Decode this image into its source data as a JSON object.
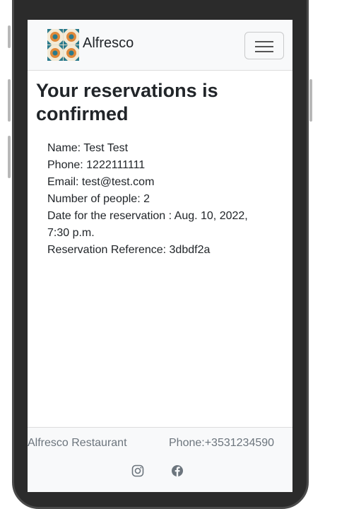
{
  "header": {
    "brand": "Alfresco",
    "menu_icon": "hamburger-menu-icon"
  },
  "main": {
    "title": "Your reservations is confirmed",
    "details": [
      "Name: Test Test",
      "Phone: 1222111111",
      "Email: test@test.com",
      "Number of people: 2",
      "Date for the reservation : Aug. 10, 2022, 7:30 p.m.",
      "Reservation Reference: 3dbdf2a"
    ]
  },
  "footer": {
    "name": "Alfresco Restaurant",
    "phone": "Phone:+3531234590",
    "social_icons": [
      "instagram-icon",
      "facebook-icon"
    ]
  },
  "colors": {
    "navbar_bg": "#f8f9fa",
    "text_primary": "#212529",
    "text_muted": "#6c757d",
    "logo_orange": "#e0893a",
    "logo_teal": "#2a7a8c"
  }
}
